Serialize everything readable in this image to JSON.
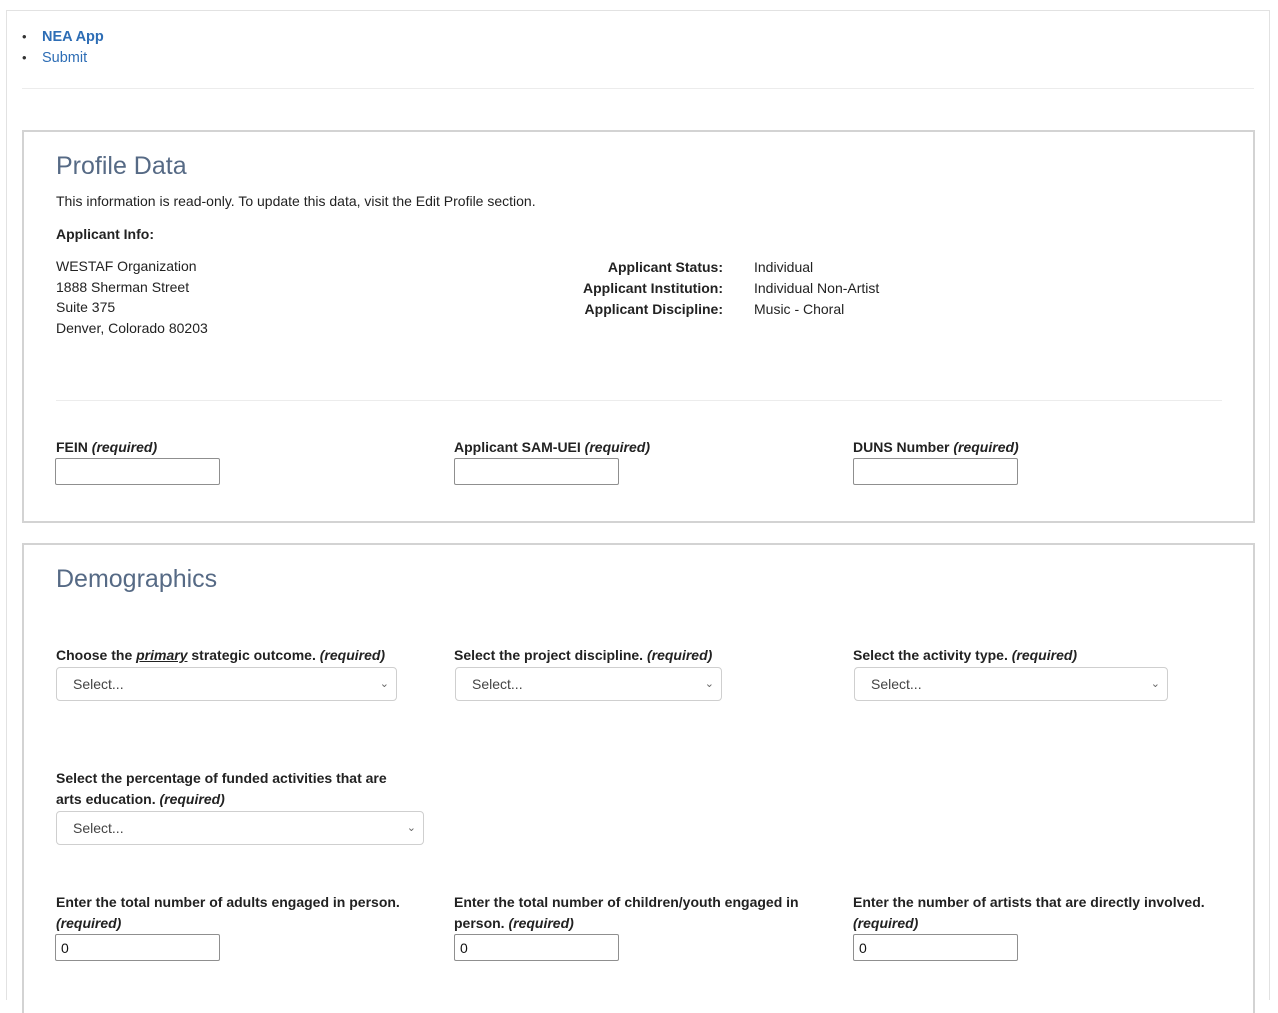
{
  "nav": {
    "app_link": "NEA App",
    "submit_link": "Submit"
  },
  "profile": {
    "title": "Profile Data",
    "note": "This information is read-only. To update this data, visit the Edit Profile section.",
    "applicant_info_label": "Applicant Info:",
    "address": [
      "WESTAF Organization",
      "1888 Sherman Street",
      "Suite 375",
      "Denver, Colorado 80203"
    ],
    "status_label": "Applicant Status:",
    "status_value": "Individual",
    "institution_label": "Applicant Institution:",
    "institution_value": "Individual Non-Artist",
    "discipline_label": "Applicant Discipline:",
    "discipline_value": "Music - Choral",
    "fein_label": "FEIN",
    "sam_label": "Applicant SAM-UEI",
    "duns_label": "DUNS Number",
    "required": "(required)",
    "fein_value": "",
    "sam_value": "",
    "duns_value": ""
  },
  "demographics": {
    "title": "Demographics",
    "outcome_label_pre": "Choose the",
    "outcome_label_em": "primary",
    "outcome_label_post": "strategic outcome.",
    "discipline_label": "Select the project discipline.",
    "activity_label": "Select the activity type.",
    "percentage_label_line1": "Select the percentage of funded activities that are",
    "percentage_label_line2": "arts education.",
    "adults_label": "Enter the total number of adults engaged in person.",
    "children_label_line1": "Enter the total number of children/youth engaged in",
    "children_label_line2": "person.",
    "artists_label": "Enter the number of artists that are directly involved.",
    "required": "(required)",
    "select_placeholder": "Select...",
    "adults_value": "0",
    "children_value": "0",
    "artists_value": "0"
  }
}
